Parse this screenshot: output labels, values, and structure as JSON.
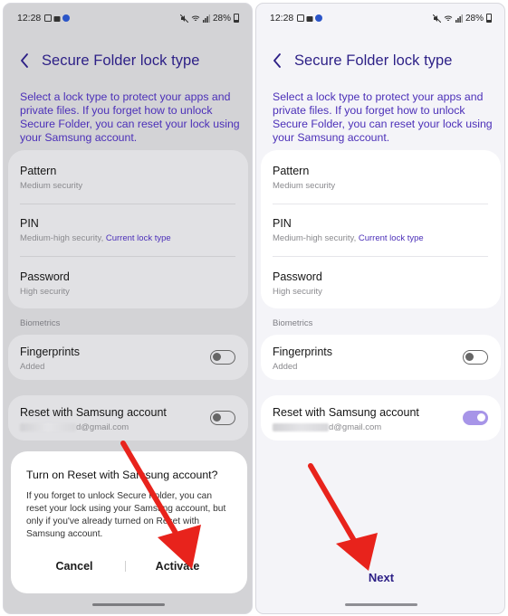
{
  "status": {
    "time": "12:28",
    "battery": "28%"
  },
  "screen": {
    "title": "Secure Folder lock type",
    "description": "Select a lock type to protect your apps and private files. If you forget how to unlock Secure Folder, you can reset your lock using your Samsung account."
  },
  "lock_types": [
    {
      "title": "Pattern",
      "subtitle": "Medium security"
    },
    {
      "title": "PIN",
      "subtitle": "Medium-high security, ",
      "current": "Current lock type"
    },
    {
      "title": "Password",
      "subtitle": "High security"
    }
  ],
  "biometrics": {
    "label": "Biometrics",
    "fingerprints": {
      "title": "Fingerprints",
      "subtitle": "Added"
    }
  },
  "reset": {
    "title": "Reset with Samsung account",
    "email_suffix": "d@gmail.com"
  },
  "toggles": {
    "left_reset": false,
    "right_reset": true,
    "fingerprints": false
  },
  "dialog": {
    "title": "Turn on Reset with Samsung account?",
    "body": "If you forget to unlock Secure Folder, you can reset your lock using your Samsung account, but only if you've already turned on Reset with Samsung account.",
    "cancel": "Cancel",
    "activate": "Activate"
  },
  "next_label": "Next",
  "colors": {
    "accent": "#2c1f86",
    "link": "#4b2fb8",
    "toggle_on": "#a795e8",
    "arrow": "#e8231c"
  }
}
